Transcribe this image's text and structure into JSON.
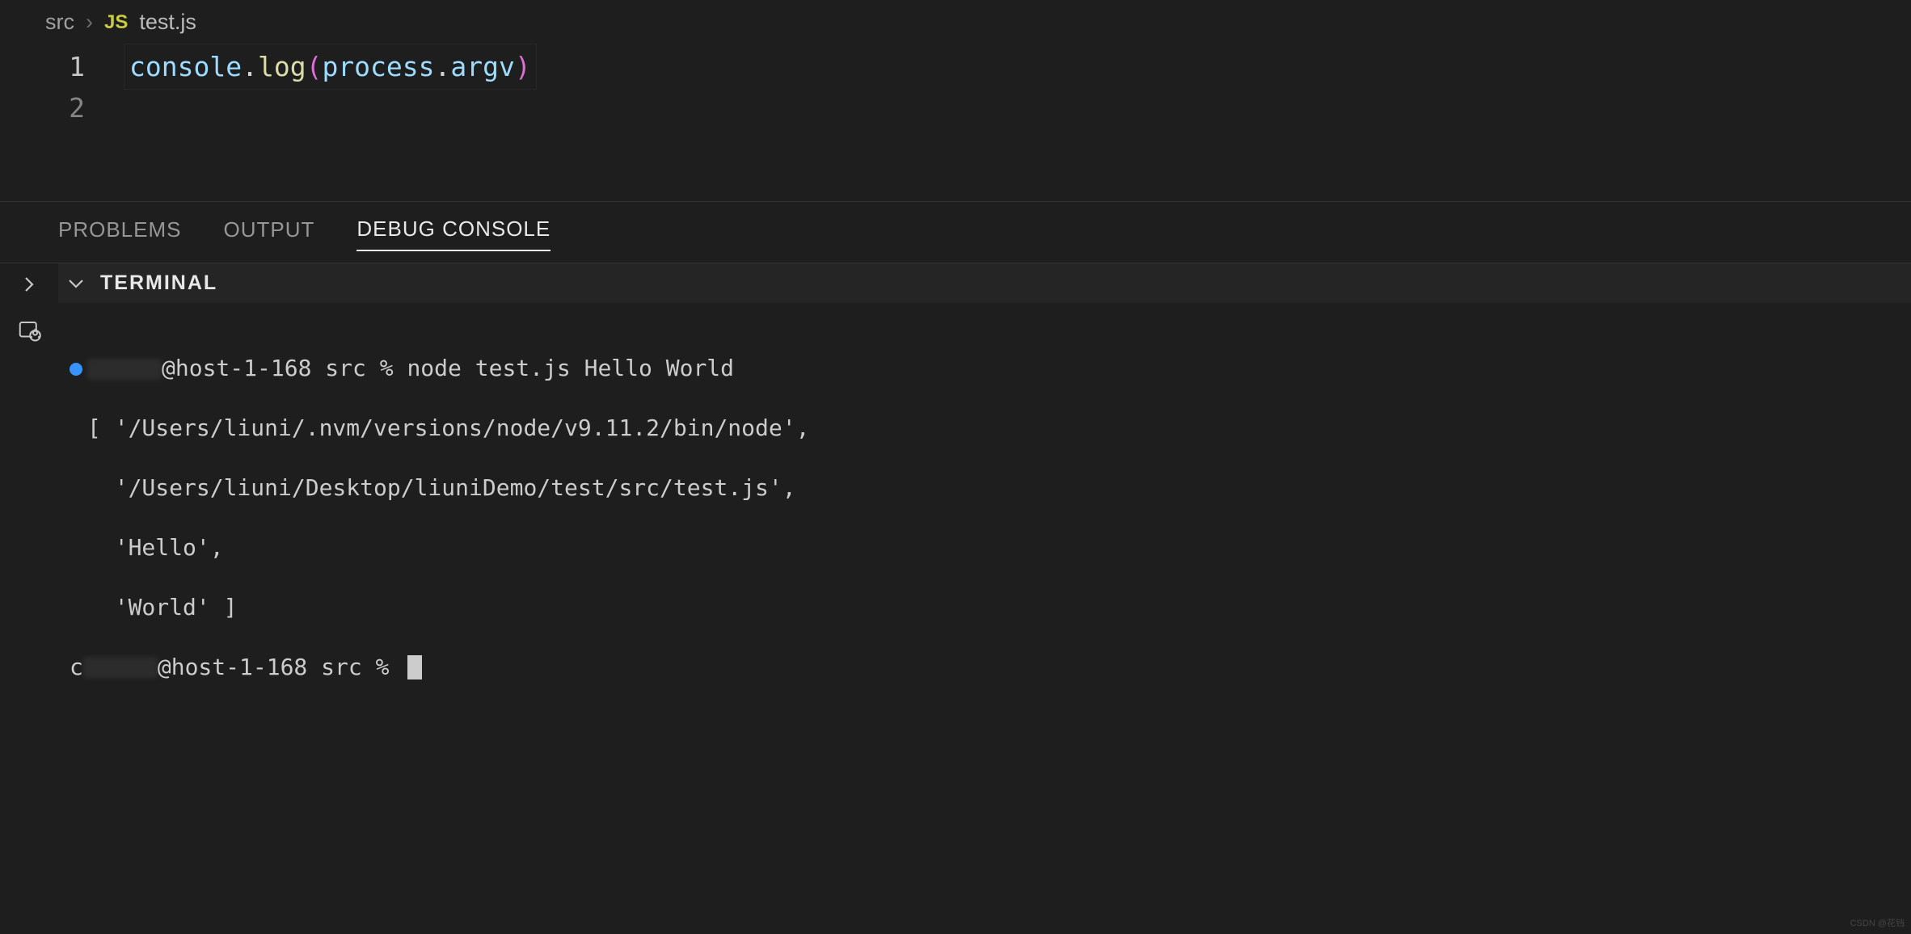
{
  "breadcrumb": {
    "root": "src",
    "js_label": "JS",
    "file": "test.js"
  },
  "editor": {
    "lines": [
      {
        "num": "1",
        "active": true
      },
      {
        "num": "2",
        "active": false
      }
    ],
    "code1": {
      "console": "console",
      "dot1": ".",
      "log": "log",
      "lparen": "(",
      "process": "process",
      "dot2": ".",
      "argv": "argv",
      "rparen": ")"
    }
  },
  "panel": {
    "tabs": {
      "problems": "PROBLEMS",
      "output": "OUTPUT",
      "debug_console": "DEBUG CONSOLE"
    },
    "terminal_label": "TERMINAL",
    "terminal": {
      "prompt1_user_at": "@host-1-168 src % ",
      "command": "node test.js Hello World",
      "out1": "[ '/Users/liuni/.nvm/versions/node/v9.11.2/bin/node',",
      "out2": "  '/Users/liuni/Desktop/liuniDemo/test/src/test.js',",
      "out3": "  'Hello',",
      "out4": "  'World' ]",
      "prompt2_prefix": "c",
      "prompt2_user_at": "@host-1-168 src % "
    }
  },
  "watermark": "CSDN @花铛"
}
